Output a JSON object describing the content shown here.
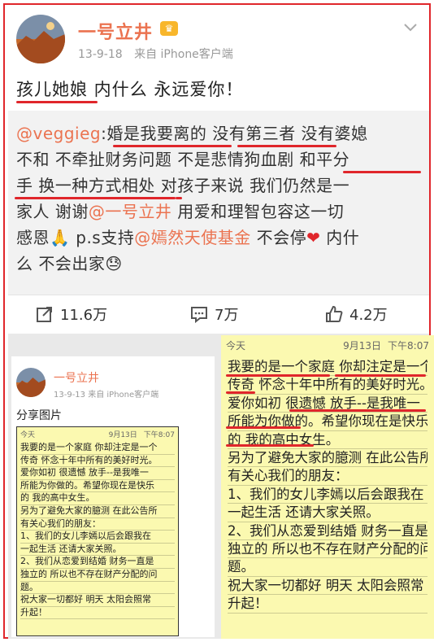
{
  "header": {
    "username": "一号立井",
    "vip_badge": "♛",
    "date": "13-9-18",
    "source": "来自 iPhone客户端"
  },
  "post": {
    "text": "孩儿她娘 内什么 永远爱你！"
  },
  "repost": {
    "mention": "@veggieg",
    "lines": [
      [
        {
          "t": ":婚是我要离的 没有第三者 没有婆媳"
        }
      ],
      [
        {
          "t": "不和 不牵扯财务问题 不是悲情狗血剧 和平分"
        }
      ],
      [
        {
          "t": "手 换一种方式相处 对孩子来说 我们仍然是一"
        }
      ],
      [
        {
          "t": "家人 谢谢"
        },
        {
          "t": "@一号立井",
          "m": true
        },
        {
          "t": " 用爱和理智包容这一切"
        }
      ],
      [
        {
          "t": "感恩🙏 p.s支持"
        },
        {
          "t": "@嫣然天使基金",
          "m": true
        },
        {
          "t": " 不会停"
        },
        {
          "t": "❤",
          "h": true
        },
        {
          "t": " 内什"
        }
      ],
      [
        {
          "t": "么 不会出家😓"
        }
      ]
    ]
  },
  "actions": {
    "repost_count": "11.6万",
    "comment_count": "7万",
    "like_count": "4.2万"
  },
  "thumb": {
    "username": "一号立井",
    "meta": "13-9-13  来自 iPhone客户端",
    "share_label": "分享图片"
  },
  "note": {
    "today": "今天",
    "date": "9月13日",
    "time": "下午8:07",
    "small_lines": [
      "我要的是一个家庭 你却注定是一个",
      "传奇 怀念十年中所有的美好时光。",
      "爱你如初 很遗憾 放手--是我唯一",
      "所能为你做的。希望你现在是快乐",
      "的 我的高中女生。",
      "另为了避免大家的臆测 在此公告所",
      "有关心我们的朋友：",
      "1、我们的女儿李嫣以后会跟我在",
      "一起生活 还请大家关照。",
      "2、我们从恋爱到结婚 财务一直是",
      "独立的 所以也不存在财产分配的问",
      "题。",
      "祝大家一切都好  明天 太阳会照常",
      "升起！"
    ],
    "big_lines": [
      "我要的是一个家庭 你却注定是一个",
      "传奇 怀念十年中所有的美好时光。",
      "爱你如初  很遗憾 放手--是我唯一",
      "所能为你做的。希望你现在是快乐",
      "的  我的高中女生。",
      "另为了避免大家的臆测 在此公告所",
      "有关心我们的朋友：",
      "1、我们的女儿李嫣以后会跟我在",
      "一起生活 还请大家关照。",
      "2、我们从恋爱到结婚  财务一直是",
      "独立的 所以也不存在财产分配的问",
      "题。",
      "祝大家一切都好  明天  太阳会照常",
      "升起！"
    ]
  },
  "colors": {
    "accent": "#eb7350",
    "highlight_red": "#e0262b",
    "note_yellow": "#fbf9b0"
  }
}
